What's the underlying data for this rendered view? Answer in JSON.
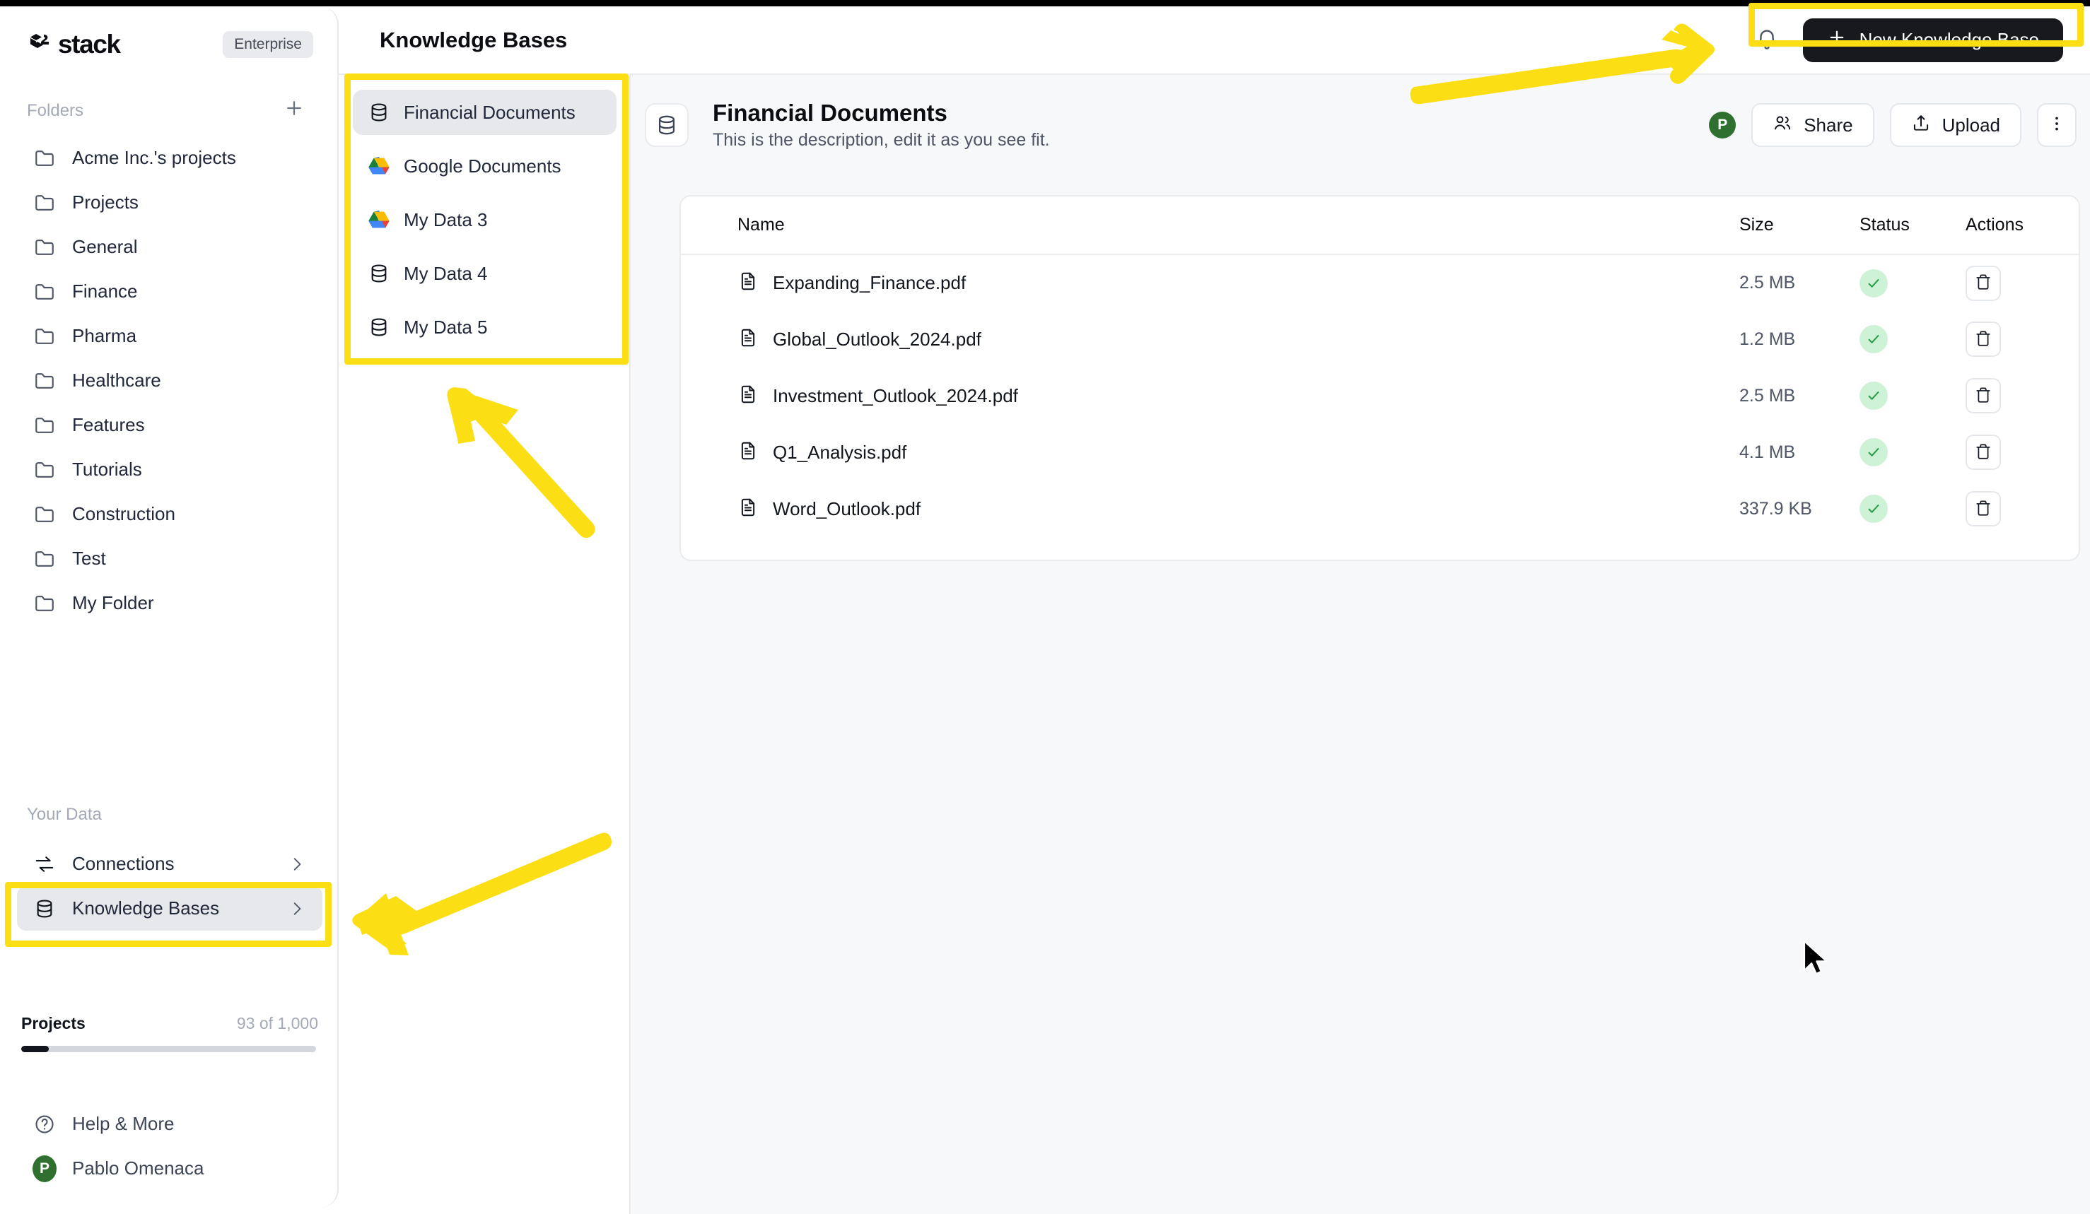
{
  "brand": {
    "name": "stack",
    "plan_badge": "Enterprise",
    "logo_icon": "stack-cubes-icon"
  },
  "sidebar": {
    "folders_label": "Folders",
    "add_folder_icon": "plus-icon",
    "folders": [
      {
        "label": "Acme Inc.'s projects",
        "icon": "folder-icon"
      },
      {
        "label": "Projects",
        "icon": "folder-icon"
      },
      {
        "label": "General",
        "icon": "folder-icon"
      },
      {
        "label": "Finance",
        "icon": "folder-icon"
      },
      {
        "label": "Pharma",
        "icon": "folder-icon"
      },
      {
        "label": "Healthcare",
        "icon": "folder-icon"
      },
      {
        "label": "Features",
        "icon": "folder-icon"
      },
      {
        "label": "Tutorials",
        "icon": "folder-icon"
      },
      {
        "label": "Construction",
        "icon": "folder-icon"
      },
      {
        "label": "Test",
        "icon": "folder-icon"
      },
      {
        "label": "My Folder",
        "icon": "folder-icon"
      }
    ],
    "your_data_label": "Your Data",
    "data_items": [
      {
        "label": "Connections",
        "icon": "transfer-arrows-icon",
        "chevron": "chevron-right-icon",
        "active": false
      },
      {
        "label": "Knowledge Bases",
        "icon": "database-icon",
        "chevron": "chevron-right-icon",
        "active": true
      }
    ],
    "usage": {
      "title": "Projects",
      "count_text": "93 of 1,000",
      "percent": 9.3
    },
    "help": {
      "label": "Help & More",
      "icon": "question-circle-icon"
    },
    "user": {
      "name": "Pablo Omenaca",
      "initial": "P",
      "avatar_color": "#2f7030"
    }
  },
  "topbar": {
    "page_title": "Knowledge Bases",
    "notifications_icon": "bell-icon",
    "new_kb_label": "New Knowledge Base",
    "new_kb_icon": "plus-icon"
  },
  "kb_list": [
    {
      "label": "Financial Documents",
      "icon": "database-icon",
      "active": true
    },
    {
      "label": "Google Documents",
      "icon": "google-drive-icon",
      "active": false
    },
    {
      "label": "My Data 3",
      "icon": "google-drive-icon",
      "active": false
    },
    {
      "label": "My Data 4",
      "icon": "database-icon",
      "active": false
    },
    {
      "label": "My Data 5",
      "icon": "database-icon",
      "active": false
    }
  ],
  "content": {
    "icon": "database-icon",
    "title": "Financial Documents",
    "description": "This is the description, edit it as you see fit.",
    "avatar_initial": "P",
    "share_label": "Share",
    "share_icon": "users-icon",
    "upload_label": "Upload",
    "upload_icon": "upload-icon",
    "more_icon": "vertical-dots-icon"
  },
  "table": {
    "columns": [
      "Name",
      "Size",
      "Status",
      "Actions"
    ],
    "rows": [
      {
        "name": "Expanding_Finance.pdf",
        "size": "2.5 MB",
        "status": "ready",
        "file_icon": "document-icon",
        "action_icon": "trash-icon"
      },
      {
        "name": "Global_Outlook_2024.pdf",
        "size": "1.2 MB",
        "status": "ready",
        "file_icon": "document-icon",
        "action_icon": "trash-icon"
      },
      {
        "name": "Investment_Outlook_2024.pdf",
        "size": "2.5 MB",
        "status": "ready",
        "file_icon": "document-icon",
        "action_icon": "trash-icon"
      },
      {
        "name": "Q1_Analysis.pdf",
        "size": "4.1 MB",
        "status": "ready",
        "file_icon": "document-icon",
        "action_icon": "trash-icon"
      },
      {
        "name": "Word_Outlook.pdf",
        "size": "337.9 KB",
        "status": "ready",
        "file_icon": "document-icon",
        "action_icon": "trash-icon"
      }
    ]
  },
  "annotations": {
    "highlight_color": "#fbdf14",
    "boxes": [
      "new-knowledge-base-button",
      "knowledge-base-list-panel",
      "sidebar-knowledge-bases-item"
    ],
    "arrows": [
      "arrow-to-new-knowledge-base-button",
      "arrow-to-knowledge-base-list",
      "arrow-to-sidebar-knowledge-bases"
    ]
  },
  "colors": {
    "accent_yellow": "#fbdf14",
    "dark_button": "#17191c",
    "status_green": "#2e9e4f",
    "status_green_bg": "#cdf2d6",
    "avatar_green": "#2f7030",
    "active_bg": "#e6e8ec",
    "main_bg": "#f7f8fa"
  }
}
